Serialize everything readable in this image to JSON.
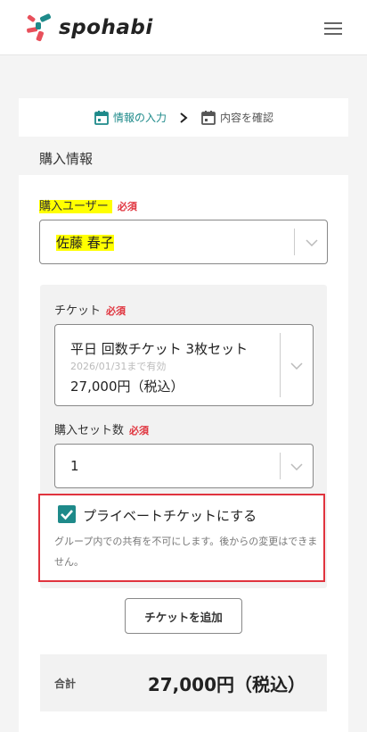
{
  "header": {
    "app_name": "spohabi",
    "menu_icon": "hamburger-menu-icon"
  },
  "steps": {
    "step1_label": "情報の入力",
    "step2_label": "内容を確認",
    "step_icon": "calendar-icon",
    "separator_icon": "chevron-right-icon"
  },
  "section_title": "購入情報",
  "purchase_user": {
    "label": "購入ユーザー",
    "required": "必須",
    "value": "佐藤 春子"
  },
  "ticket": {
    "label": "チケット",
    "required": "必須",
    "name": "平日 回数チケット 3枚セット",
    "validity": "2026/01/31まで有効",
    "price": "27,000円（税込）"
  },
  "set_count": {
    "label": "購入セット数",
    "required": "必須",
    "value": "1"
  },
  "private": {
    "checked": true,
    "label": "プライベートチケットにする",
    "note": "グループ内での共有を不可にします。後からの変更はできません。"
  },
  "add_ticket_label": "チケットを追加",
  "total": {
    "label": "合計",
    "value": "27,000円（税込）"
  },
  "colors": {
    "accent": "#1e8a8a",
    "required": "#e0343e",
    "highlight": "#ffff00"
  }
}
